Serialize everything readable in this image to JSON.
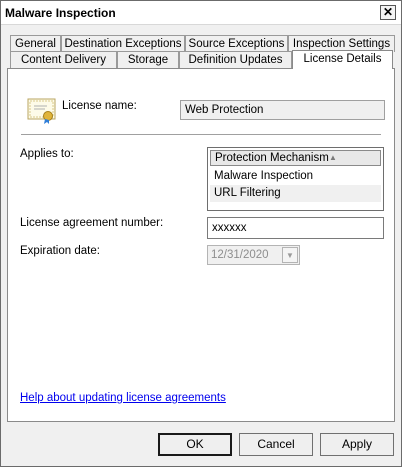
{
  "window": {
    "title": "Malware Inspection",
    "close_glyph": "✕"
  },
  "tabs_row1": [
    {
      "label": "General"
    },
    {
      "label": "Destination Exceptions"
    },
    {
      "label": "Source Exceptions"
    },
    {
      "label": "Inspection Settings"
    }
  ],
  "tabs_row2": [
    {
      "label": "Content Delivery"
    },
    {
      "label": "Storage"
    },
    {
      "label": "Definition Updates"
    },
    {
      "label": "License Details",
      "active": true
    }
  ],
  "license": {
    "icon": "certificate-icon",
    "name_label": "License name:",
    "name_value": "Web Protection",
    "applies_label": "Applies to:",
    "applies_header": "Protection Mechanism",
    "applies_items": [
      "Malware Inspection",
      "URL Filtering"
    ],
    "agreement_label": "License agreement number:",
    "agreement_value": "xxxxxx",
    "expiration_label": "Expiration date:",
    "expiration_value": "12/31/2020",
    "help_link": "Help about updating license agreements"
  },
  "buttons": {
    "ok": "OK",
    "cancel": "Cancel",
    "apply": "Apply"
  },
  "colors": {
    "dialog_bg": "#f0f0f0",
    "panel_bg": "#ffffff",
    "link": "#0000ee"
  }
}
